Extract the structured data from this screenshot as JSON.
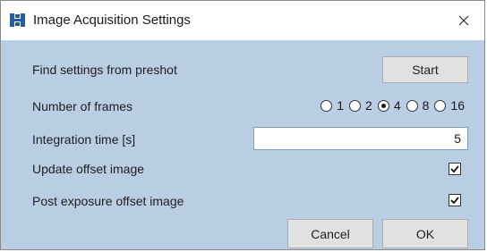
{
  "window": {
    "title": "Image Acquisition Settings",
    "close_glyph": "✕"
  },
  "preshot": {
    "label": "Find settings from preshot",
    "button_label": "Start"
  },
  "frames": {
    "label": "Number of frames",
    "options": [
      {
        "label": "1",
        "checked": false
      },
      {
        "label": "2",
        "checked": false
      },
      {
        "label": "4",
        "checked": true
      },
      {
        "label": "8",
        "checked": false
      },
      {
        "label": "16",
        "checked": false
      }
    ]
  },
  "integration": {
    "label": "Integration time [s]",
    "value": "5"
  },
  "update_offset": {
    "label": "Update offset image",
    "checked": true
  },
  "post_exposure": {
    "label": "Post exposure offset image",
    "checked": true
  },
  "footer": {
    "cancel_label": "Cancel",
    "ok_label": "OK"
  },
  "colors": {
    "dialog_bg": "#b9cde3",
    "button_bg": "#e1e1e1",
    "icon_blue": "#1f5fa8"
  }
}
